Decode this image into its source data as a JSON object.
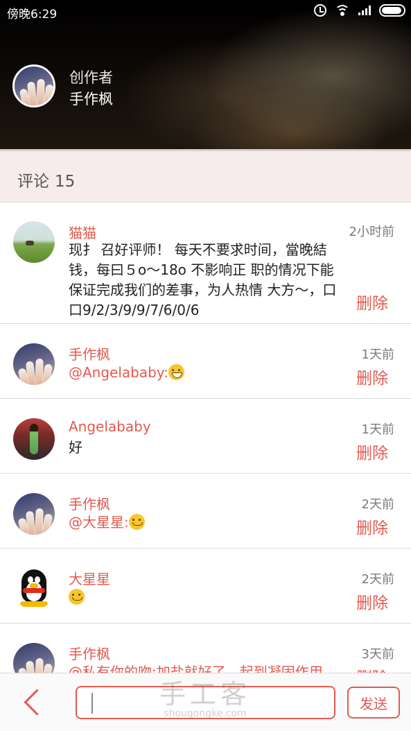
{
  "status_bar": {
    "time": "傍晚6:29",
    "icons": [
      "alarm-icon",
      "wifi-icon",
      "signal-icon",
      "battery-icon"
    ]
  },
  "creator": {
    "label": "创作者",
    "name": "手作枫"
  },
  "comments_header": {
    "label": "评论",
    "count": "15"
  },
  "comments": [
    {
      "user": "猫猫",
      "avatar": "grassland-photo",
      "text": "现扌 召好评师！ 每天不要求时间，當晚結钱，每曰５o～18o 不影响正 职的情况下能保证完成我们的差事，为人热情 大方～，口口9/2/3/9/9/7/6/0/6",
      "time": "2小时前",
      "delete_label": "删除"
    },
    {
      "user": "手作枫",
      "avatar": "nails-photo",
      "mention": "@Angelababy:",
      "emoji": "grin-emoji",
      "time": "1天前",
      "delete_label": "删除"
    },
    {
      "user": "Angelababy",
      "avatar": "person-photo",
      "text": "好",
      "time": "1天前",
      "delete_label": "删除"
    },
    {
      "user": "手作枫",
      "avatar": "nails-photo",
      "mention": "@大星星:",
      "emoji": "wink-emoji",
      "time": "2天前",
      "delete_label": "删除"
    },
    {
      "user": "大星星",
      "avatar": "qq-penguin",
      "emoji": "smile-emoji",
      "time": "2天前",
      "delete_label": "删除"
    },
    {
      "user": "手作枫",
      "avatar": "nails-photo",
      "text": "@私有你的吻:加盐就好了，起到凝固作用",
      "time": "3天前",
      "delete_label": "删除"
    }
  ],
  "input_bar": {
    "placeholder": "",
    "send_label": "发送"
  },
  "watermark": {
    "brand": "手工客",
    "domain": "shougongke.com"
  },
  "colors": {
    "accent": "#e45a4f",
    "count_bar_bg": "#f7ecec"
  }
}
